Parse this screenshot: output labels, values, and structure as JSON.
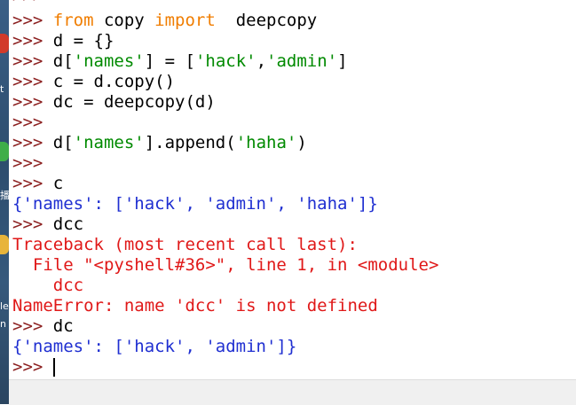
{
  "desktop": {
    "glyph_top": "t",
    "glyph_mid": "播",
    "glyph_low": "le",
    "glyph_bottom": "n"
  },
  "shell": {
    "top_clipped_prompt": ">>>",
    "lines": [
      {
        "segments": [
          {
            "t": ">>> ",
            "c": "p"
          },
          {
            "t": "from",
            "c": "kw"
          },
          {
            "t": " copy ",
            "c": "n"
          },
          {
            "t": "import",
            "c": "kw"
          },
          {
            "t": "  deepcopy",
            "c": "n"
          }
        ]
      },
      {
        "segments": [
          {
            "t": ">>> ",
            "c": "p"
          },
          {
            "t": "d = {}",
            "c": "n"
          }
        ]
      },
      {
        "segments": [
          {
            "t": ">>> ",
            "c": "p"
          },
          {
            "t": "d[",
            "c": "n"
          },
          {
            "t": "'names'",
            "c": "st"
          },
          {
            "t": "] = [",
            "c": "n"
          },
          {
            "t": "'hack'",
            "c": "st"
          },
          {
            "t": ",",
            "c": "n"
          },
          {
            "t": "'admin'",
            "c": "st"
          },
          {
            "t": "]",
            "c": "n"
          }
        ]
      },
      {
        "segments": [
          {
            "t": ">>> ",
            "c": "p"
          },
          {
            "t": "c = d.copy()",
            "c": "n"
          }
        ]
      },
      {
        "segments": [
          {
            "t": ">>> ",
            "c": "p"
          },
          {
            "t": "dc = deepcopy(d)",
            "c": "n"
          }
        ]
      },
      {
        "segments": [
          {
            "t": ">>>",
            "c": "p"
          }
        ]
      },
      {
        "segments": [
          {
            "t": ">>> ",
            "c": "p"
          },
          {
            "t": "d[",
            "c": "n"
          },
          {
            "t": "'names'",
            "c": "st"
          },
          {
            "t": "].append(",
            "c": "n"
          },
          {
            "t": "'haha'",
            "c": "st"
          },
          {
            "t": ")",
            "c": "n"
          }
        ]
      },
      {
        "segments": [
          {
            "t": ">>>",
            "c": "p"
          }
        ]
      },
      {
        "segments": [
          {
            "t": ">>> ",
            "c": "p"
          },
          {
            "t": "c",
            "c": "n"
          }
        ]
      },
      {
        "segments": [
          {
            "t": "{'names': ['hack', 'admin', 'haha']}",
            "c": "out"
          }
        ]
      },
      {
        "segments": [
          {
            "t": ">>> ",
            "c": "p"
          },
          {
            "t": "dcc",
            "c": "n"
          }
        ]
      },
      {
        "segments": [
          {
            "t": "Traceback (most recent call last):",
            "c": "err"
          }
        ]
      },
      {
        "segments": [
          {
            "t": "  File \"<pyshell#36>\", line 1, in <module>",
            "c": "err"
          }
        ]
      },
      {
        "segments": [
          {
            "t": "    dcc",
            "c": "err"
          }
        ]
      },
      {
        "segments": [
          {
            "t": "NameError: name 'dcc' is not defined",
            "c": "err"
          }
        ]
      },
      {
        "segments": [
          {
            "t": ">>> ",
            "c": "p"
          },
          {
            "t": "dc",
            "c": "n"
          }
        ]
      },
      {
        "segments": [
          {
            "t": "{'names': ['hack', 'admin']}",
            "c": "out"
          }
        ]
      },
      {
        "segments": [
          {
            "t": ">>> ",
            "c": "p"
          }
        ]
      }
    ]
  },
  "colors": {
    "prompt": "#8b1e1e",
    "keyword": "#f07d00",
    "string": "#008a00",
    "output": "#1f2fd1",
    "error": "#e01818"
  }
}
